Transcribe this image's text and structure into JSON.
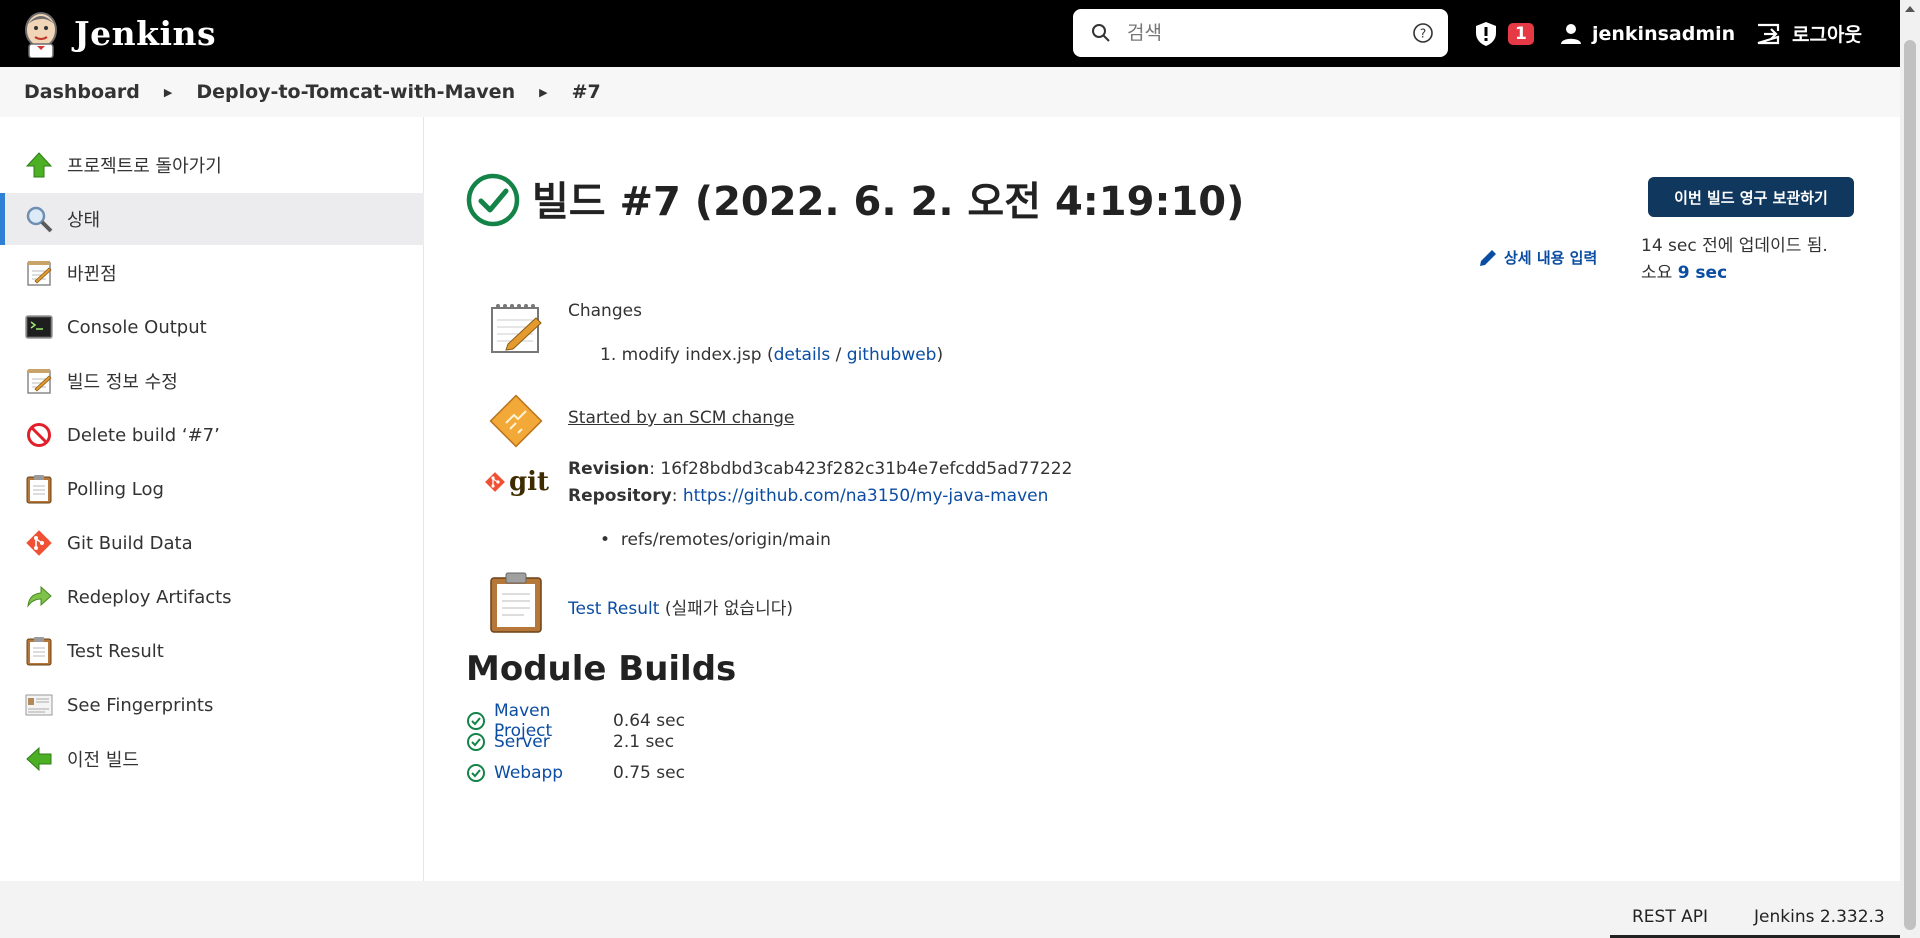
{
  "header": {
    "brand": "Jenkins",
    "search_placeholder": "검색",
    "alerts_count": "1",
    "username": "jenkinsadmin",
    "logout_label": "로그아웃"
  },
  "breadcrumb": [
    "Dashboard",
    "Deploy-to-Tomcat-with-Maven",
    "#7"
  ],
  "sidebar": {
    "items": [
      {
        "label": "프로젝트로 돌아가기",
        "icon": "up-arrow-icon"
      },
      {
        "label": "상태",
        "icon": "magnifier-icon"
      },
      {
        "label": "바뀐점",
        "icon": "notepad-icon"
      },
      {
        "label": "Console Output",
        "icon": "terminal-icon"
      },
      {
        "label": "빌드 정보 수정",
        "icon": "notepad-icon"
      },
      {
        "label": "Delete build ‘#7’",
        "icon": "no-entry-icon"
      },
      {
        "label": "Polling Log",
        "icon": "clipboard-icon"
      },
      {
        "label": "Git Build Data",
        "icon": "git-icon"
      },
      {
        "label": "Redeploy Artifacts",
        "icon": "redeploy-arrow-icon"
      },
      {
        "label": "Test Result",
        "icon": "clipboard-icon"
      },
      {
        "label": "See Fingerprints",
        "icon": "fingerprint-card-icon"
      },
      {
        "label": "이전 빌드",
        "icon": "left-arrow-icon"
      }
    ]
  },
  "build": {
    "title": "빌드 #7 (2022. 6. 2. 오전 4:19:10)",
    "keep_button": "이번 빌드 영구 보관하기",
    "edit_description": "상세 내용 입력",
    "updated_text": "14 sec 전에 업데이드 됨.",
    "duration_label": "소요",
    "duration_value": "9 sec"
  },
  "changes": {
    "heading": "Changes",
    "item_number": "1.",
    "item_text": "modify index.jsp",
    "details_link": "details",
    "githubweb_link": "githubweb"
  },
  "cause": {
    "text": "Started by an SCM change"
  },
  "git": {
    "logo_text": "git",
    "revision_label": "Revision",
    "revision_value": "16f28bdbd3cab423f282c31b4e7efcdd5ad77222",
    "repository_label": "Repository",
    "repository_url": "https://github.com/na3150/my-java-maven",
    "branch": "refs/remotes/origin/main"
  },
  "tests": {
    "link": "Test Result",
    "suffix": "(실패가 없습니다)"
  },
  "modules": {
    "heading": "Module Builds",
    "items": [
      {
        "name": "Maven Project",
        "time": "0.64 sec"
      },
      {
        "name": "Server",
        "time": "2.1 sec"
      },
      {
        "name": "Webapp",
        "time": "0.75 sec"
      }
    ]
  },
  "footer": {
    "rest_api": "REST API",
    "version": "Jenkins 2.332.3"
  },
  "colors": {
    "header_bg": "#000000",
    "link": "#0b4da2",
    "success": "#138347",
    "keep_button_bg": "#10385e",
    "badge_bg": "#e63946",
    "active_marker": "#2f80d4"
  }
}
